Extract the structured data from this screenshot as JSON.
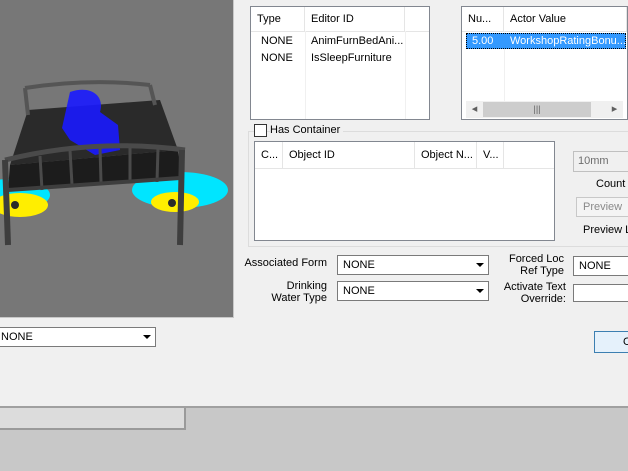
{
  "type_list": {
    "columns": [
      "Type",
      "Editor ID"
    ],
    "rows": [
      {
        "type": "NONE",
        "editor_id": "AnimFurnBedAni..."
      },
      {
        "type": "NONE",
        "editor_id": "IsSleepFurniture"
      }
    ]
  },
  "actor_values": {
    "columns": [
      "Nu...",
      "Actor Value"
    ],
    "rows": [
      {
        "num": "5.00",
        "actor_value": "WorkshopRatingBonu..."
      }
    ],
    "scroll_grip": "|||"
  },
  "has_container": {
    "label": "Has Container"
  },
  "container_list": {
    "columns": [
      "C...",
      "Object ID",
      "Object N...",
      "V..."
    ]
  },
  "preview": {
    "distance_value": "10mm",
    "count_label": "Count",
    "preview_button": "Preview",
    "preview_label": "Preview L"
  },
  "form_fields": {
    "associated_form_label": "Associated Form",
    "associated_form_value": "NONE",
    "drinking_water_label_1": "Drinking",
    "drinking_water_label_2": "Water Type",
    "drinking_water_value": "NONE",
    "forced_loc_label_1": "Forced Loc",
    "forced_loc_label_2": "Ref Type",
    "forced_loc_value": "NONE",
    "activate_text_label_1": "Activate Text",
    "activate_text_label_2": "Override:",
    "activate_text_value": ""
  },
  "left_dropdown": {
    "value": "NONE"
  },
  "ok_button": {
    "label": "O"
  },
  "colors": {
    "viewport_bg": "#777777",
    "selection": "#3399ff",
    "marker_blue": "#1a1aff",
    "marker_cyan": "#00e5ff",
    "marker_yellow": "#ffee00"
  }
}
